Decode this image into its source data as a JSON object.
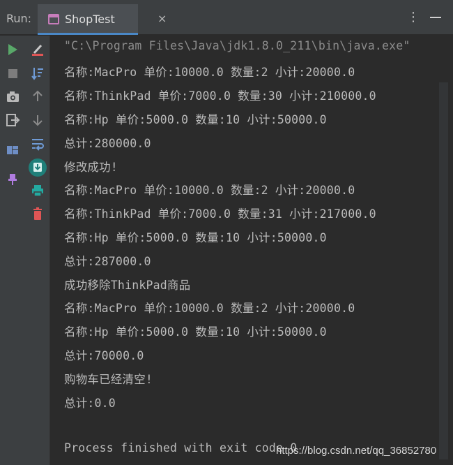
{
  "header": {
    "run_label": "Run:",
    "tab_label": "ShopTest",
    "tab_close": "×",
    "more_glyph": "⋮"
  },
  "toolbar": {
    "left": [
      "rerun-icon",
      "stop-icon",
      "camera-icon",
      "exit-icon",
      "layout-icon",
      "pin-icon"
    ],
    "right": [
      "clear-icon",
      "sort-icon",
      "up-arrow-icon",
      "down-arrow-icon",
      "soft-wrap-icon",
      "scroll-to-end-icon",
      "print-icon",
      "trash-icon"
    ]
  },
  "colors": {
    "accent": "#4a88c7",
    "run_green": "#59a869",
    "danger_red": "#e05555",
    "teal": "#23a9a0",
    "tab_icon": "#c77dbb"
  },
  "console": {
    "lines": [
      "\"C:\\Program Files\\Java\\jdk1.8.0_211\\bin\\java.exe\"",
      "名称:MacPro 单价:10000.0 数量:2 小计:20000.0",
      "名称:ThinkPad 单价:7000.0 数量:30 小计:210000.0",
      "名称:Hp 单价:5000.0 数量:10 小计:50000.0",
      "总计:280000.0",
      "修改成功!",
      "名称:MacPro 单价:10000.0 数量:2 小计:20000.0",
      "名称:ThinkPad 单价:7000.0 数量:31 小计:217000.0",
      "名称:Hp 单价:5000.0 数量:10 小计:50000.0",
      "总计:287000.0",
      "成功移除ThinkPad商品",
      "名称:MacPro 单价:10000.0 数量:2 小计:20000.0",
      "名称:Hp 单价:5000.0 数量:10 小计:50000.0",
      "总计:70000.0",
      "购物车已经清空!",
      "总计:0.0",
      "",
      "Process finished with exit code 0"
    ]
  },
  "watermark": "https://blog.csdn.net/qq_36852780"
}
